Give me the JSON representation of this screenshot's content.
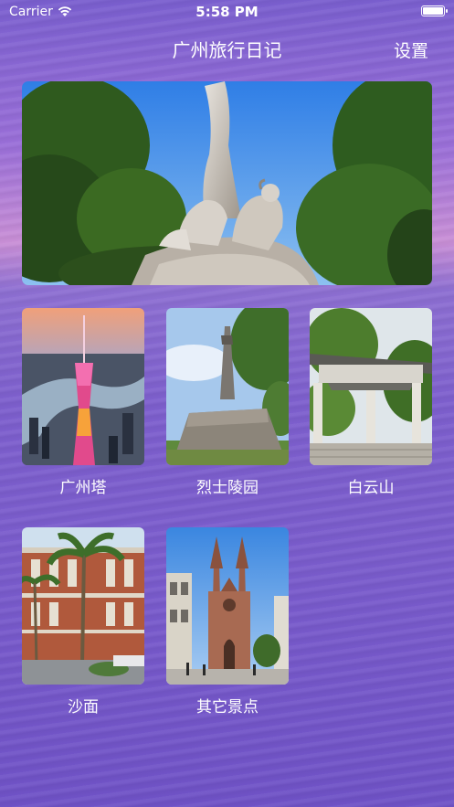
{
  "status_bar": {
    "carrier": "Carrier",
    "time": "5:58 PM",
    "wifi_icon": "wifi-icon",
    "battery_icon": "battery-icon"
  },
  "nav": {
    "title": "广州旅行日记",
    "settings_label": "设置"
  },
  "hero": {
    "image": "five-rams-statue-photo"
  },
  "spots": [
    {
      "label": "广州塔",
      "image": "canton-tower-photo"
    },
    {
      "label": "烈士陵园",
      "image": "martyrs-cemetery-photo"
    },
    {
      "label": "白云山",
      "image": "baiyun-mountain-photo"
    },
    {
      "label": "沙面",
      "image": "shamian-photo"
    },
    {
      "label": "其它景点",
      "image": "sacred-heart-cathedral-photo"
    }
  ],
  "colors": {
    "background_top": "#7a5fcf",
    "background_glow": "#c98fd6",
    "text": "#ffffff"
  }
}
